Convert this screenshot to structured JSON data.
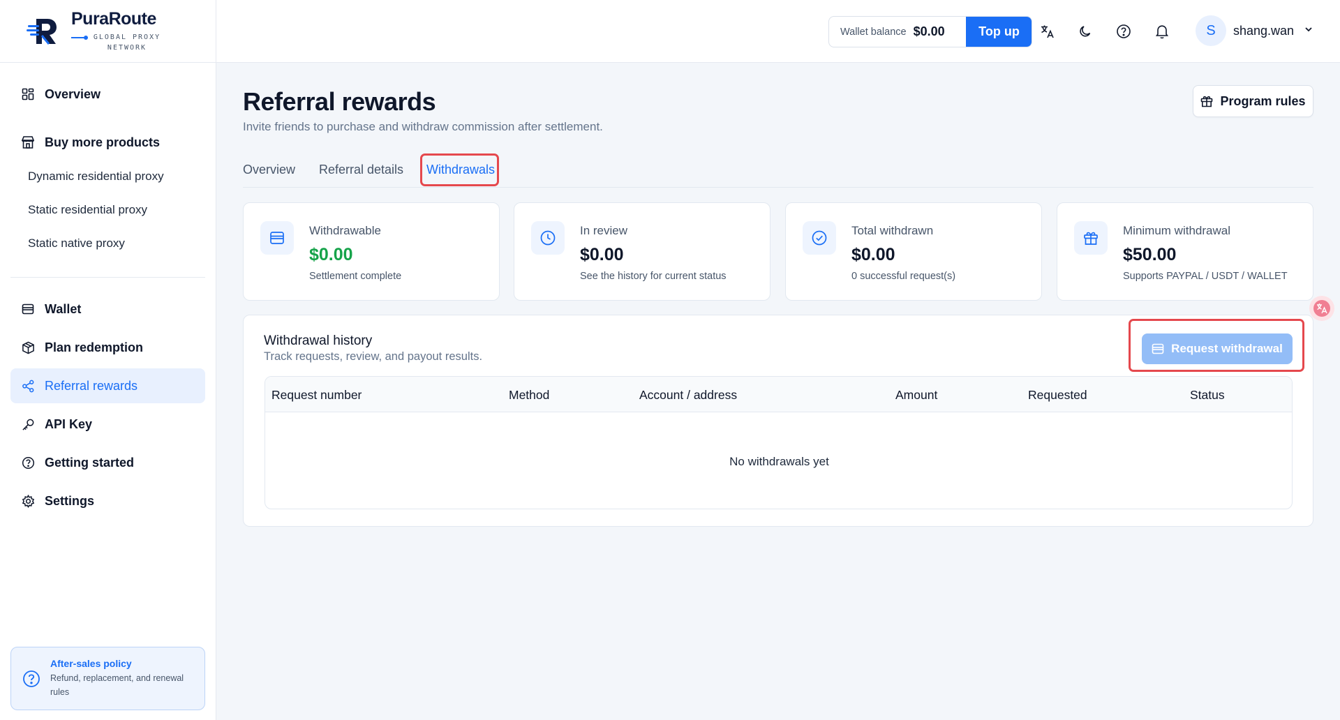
{
  "brand": {
    "name": "PuraRoute",
    "tagline": "GLOBAL PROXY NETWORK"
  },
  "sidebar": {
    "items": [
      {
        "label": "Overview",
        "icon": "grid-icon"
      },
      {
        "label": "Buy more products",
        "icon": "store-icon"
      },
      {
        "label": "Wallet",
        "icon": "wallet-icon"
      },
      {
        "label": "Plan redemption",
        "icon": "package-icon"
      },
      {
        "label": "Referral rewards",
        "icon": "share-icon",
        "active": true
      },
      {
        "label": "API Key",
        "icon": "key-icon"
      },
      {
        "label": "Getting started",
        "icon": "help-circle-icon"
      },
      {
        "label": "Settings",
        "icon": "gear-icon"
      }
    ],
    "sub_items": [
      "Dynamic residential proxy",
      "Static residential proxy",
      "Static native proxy"
    ],
    "policy": {
      "title": "After-sales policy",
      "desc": "Refund, replacement, and renewal rules"
    }
  },
  "header": {
    "wallet_label": "Wallet balance",
    "wallet_value": "$0.00",
    "topup_label": "Top up",
    "user_initial": "S",
    "username": "shang.wan"
  },
  "page": {
    "title": "Referral rewards",
    "subtitle": "Invite friends to purchase and withdraw commission after settlement.",
    "rules_label": "Program rules",
    "tabs": [
      {
        "label": "Overview"
      },
      {
        "label": "Referral details"
      },
      {
        "label": "Withdrawals",
        "active": true
      }
    ]
  },
  "cards": [
    {
      "label": "Withdrawable",
      "value": "$0.00",
      "desc": "Settlement complete",
      "icon": "wallet-card-icon",
      "value_color": "#16a34a"
    },
    {
      "label": "In review",
      "value": "$0.00",
      "desc": "See the history for current status",
      "icon": "clock-icon"
    },
    {
      "label": "Total withdrawn",
      "value": "$0.00",
      "desc": "0 successful request(s)",
      "icon": "check-circle-icon"
    },
    {
      "label": "Minimum withdrawal",
      "value": "$50.00",
      "desc": "Supports PAYPAL / USDT / WALLET",
      "icon": "gift-icon"
    }
  ],
  "history": {
    "title": "Withdrawal history",
    "subtitle": "Track requests, review, and payout results.",
    "request_label": "Request withdrawal",
    "columns": [
      "Request number",
      "Method",
      "Account / address",
      "Amount",
      "Requested",
      "Status"
    ],
    "empty_text": "No withdrawals yet"
  },
  "colors": {
    "accent": "#1a6ef5",
    "highlight": "#e5484d",
    "positive": "#16a34a"
  }
}
